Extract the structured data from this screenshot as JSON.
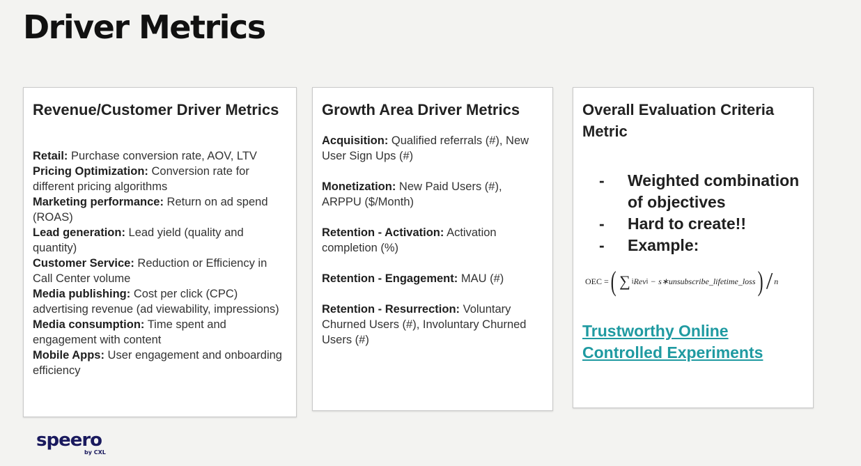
{
  "title": "Driver Metrics",
  "revenue_card": {
    "title": "Revenue/Customer Driver Metrics",
    "items": [
      {
        "label": "Retail:",
        "text": " Purchase conversion rate, AOV, LTV"
      },
      {
        "label": "Pricing Optimization:",
        "text": " Conversion rate for different pricing algorithms"
      },
      {
        "label": "Marketing performance:",
        "text": " Return on ad spend (ROAS)"
      },
      {
        "label": "Lead generation:",
        "text": " Lead yield (quality and quantity)"
      },
      {
        "label": "Customer Service:",
        "text": " Reduction or Efficiency in Call Center volume"
      },
      {
        "label": "Media publishing:",
        "text": " Cost per click (CPC) advertising revenue (ad viewability, impressions)"
      },
      {
        "label": "Media consumption:",
        "text": " Time spent and engagement with content"
      },
      {
        "label": "Mobile Apps:",
        "text": " User engagement and onboarding efficiency"
      }
    ]
  },
  "growth_card": {
    "title": "Growth Area Driver Metrics",
    "items": [
      {
        "label": "Acquisition:",
        "text": " Qualified referrals (#), New User  Sign Ups (#)"
      },
      {
        "label": "Monetization:",
        "text": " New Paid Users (#), ARPPU ($/Month)"
      },
      {
        "label": "Retention - Activation:",
        "text": " Activation completion (%)"
      },
      {
        "label": "Retention - Engagement:",
        "text": " MAU (#)"
      },
      {
        "label": "Retention - Resurrection:",
        "text": " Voluntary Churned Users (#), Involuntary Churned Users (#)"
      }
    ]
  },
  "oec_card": {
    "title": "Overall Evaluation Criteria Metric",
    "bullet_marker": "-",
    "bullets": [
      "Weighted combination of objectives",
      "Hard to create!!",
      "Example:"
    ],
    "formula": {
      "lhs": "OEC =",
      "sum": "∑",
      "sum_index": "i",
      "term1": "Rev",
      "term1_sub": "i",
      "op": "−",
      "term2": "s∗unsubscribe_lifetime_loss",
      "divisor": "n"
    },
    "link_text": "Trustworthy Online Controlled Experiments"
  },
  "logo": {
    "word": "speero",
    "sub": "by CXL"
  }
}
